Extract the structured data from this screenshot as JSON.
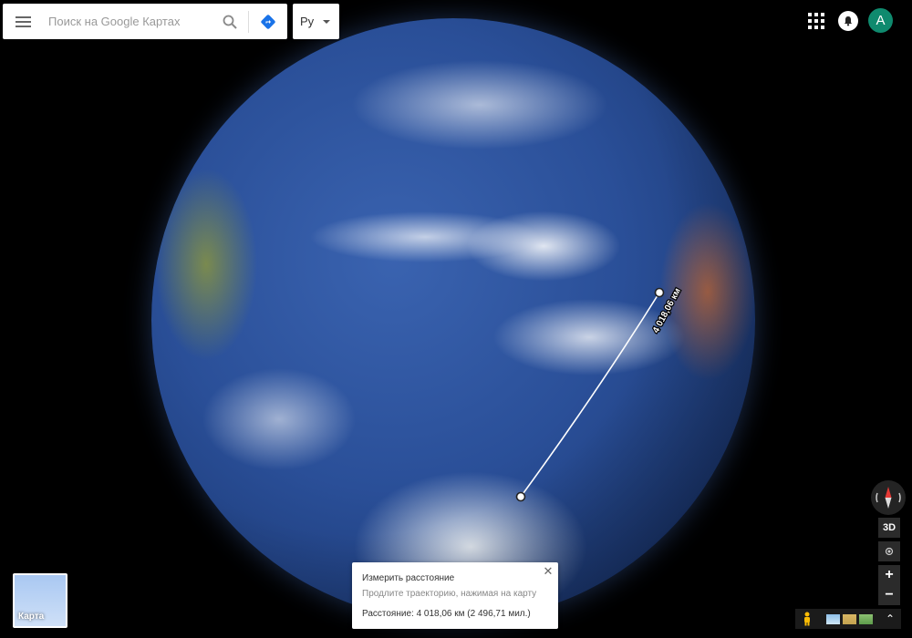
{
  "search": {
    "placeholder": "Поиск на Google Картах"
  },
  "language": {
    "selected": "Ру"
  },
  "account": {
    "avatar_letter": "A",
    "avatar_color": "#0f8a6e"
  },
  "icons": {
    "menu": "hamburger-icon",
    "search": "search-icon",
    "directions": "directions-icon",
    "apps": "apps-grid-icon",
    "notifications": "notifications-icon",
    "compass": "compass-icon",
    "locate": "my-location-icon",
    "pegman": "pegman-icon",
    "expand": "expand-icon"
  },
  "controls": {
    "btn_3d": "3D",
    "zoom_in": "+",
    "zoom_out": "−",
    "expand": "⌃"
  },
  "layer_toggle": {
    "label": "Карта"
  },
  "measure": {
    "line_label": "4 018,06 км",
    "title": "Измерить расстояние",
    "hint": "Продлите траекторию, нажимая на карту",
    "distance": "Расстояние: 4 018,06 км (2 496,71 мил.)",
    "close": "✕"
  }
}
